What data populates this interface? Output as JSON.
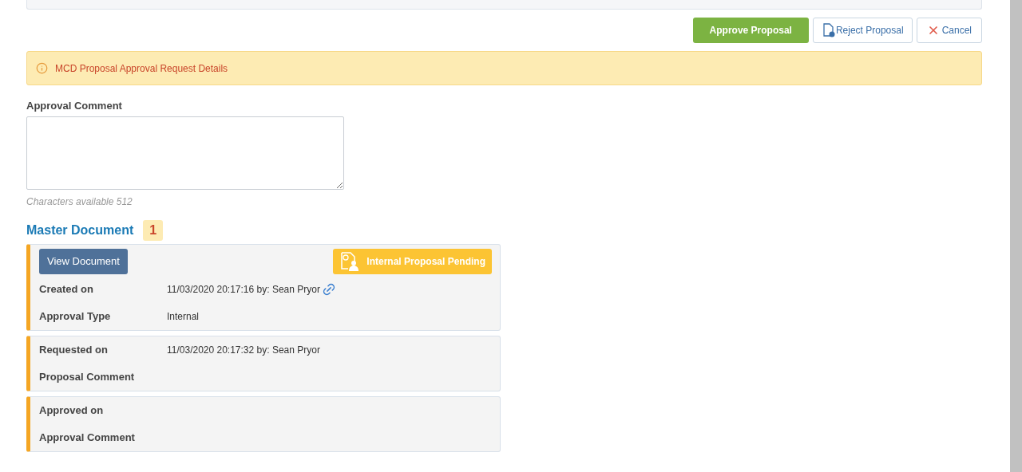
{
  "actions": [
    {
      "kind": "approve",
      "label": "Approve Proposal"
    },
    {
      "kind": "reject",
      "label": "Reject Proposal"
    },
    {
      "kind": "cancel",
      "label": "Cancel"
    }
  ],
  "alert": {
    "text": "MCD Proposal Approval Request Details"
  },
  "comment": {
    "label": "Approval Comment",
    "hint": "Characters available 512"
  },
  "section": {
    "title": "Master Document",
    "count": "1"
  },
  "cards": [
    {
      "button": "View Document",
      "status": "Internal Proposal Pending",
      "rows": [
        {
          "label": "Created on",
          "value": "11/03/2020 20:17:16 by: Sean Pryor",
          "linked": true
        },
        {
          "label": "Approval Type",
          "value": "Internal",
          "linked": false
        }
      ]
    },
    {
      "rows": [
        {
          "label": "Requested on",
          "value": "11/03/2020 20:17:32 by: Sean Pryor",
          "linked": false
        },
        {
          "label": "Proposal Comment",
          "linked": false
        }
      ]
    },
    {
      "rows": [
        {
          "label": "Approved on",
          "linked": false
        },
        {
          "label": "Approval Comment",
          "linked": false
        }
      ]
    }
  ]
}
